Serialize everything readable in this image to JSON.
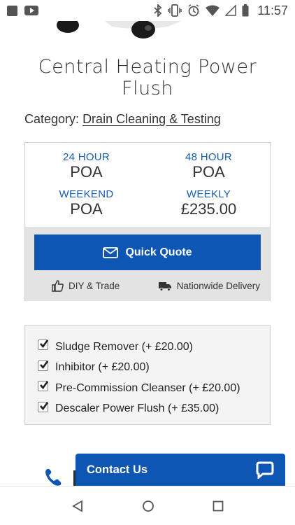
{
  "status_bar": {
    "time": "11:57"
  },
  "product": {
    "title_line1": "Central Heating Power",
    "title_line2": "Flush",
    "category_label": "Category:",
    "category_value": "Drain Cleaning & Testing"
  },
  "pricing": [
    {
      "label": "24 HOUR",
      "value": "POA"
    },
    {
      "label": "48 HOUR",
      "value": "POA"
    },
    {
      "label": "WEEKEND",
      "value": "POA"
    },
    {
      "label": "WEEKLY",
      "value": "£235.00"
    }
  ],
  "quote_button": {
    "label": "Quick Quote"
  },
  "features": {
    "diy": "DIY & Trade",
    "delivery": "Nationwide Delivery"
  },
  "options": [
    {
      "label": "Sludge Remover (+ £20.00)",
      "checked": true
    },
    {
      "label": "Inhibitor (+ £20.00)",
      "checked": true
    },
    {
      "label": "Pre-Commission Cleanser (+ £20.00)",
      "checked": true
    },
    {
      "label": "Descaler Power Flush (+ £35.00)",
      "checked": true
    }
  ],
  "contact": {
    "label": "Contact Us"
  },
  "colors": {
    "brand_blue": "#0d56b4",
    "label_blue": "#1a5cae",
    "panel_gray": "#e3e3e3"
  },
  "icons": [
    "youtube-icon",
    "bluetooth-icon",
    "vibrate-icon",
    "alarm-icon",
    "wifi-icon",
    "signal-icon",
    "battery-icon",
    "envelope-icon",
    "thumbs-up-icon",
    "truck-icon",
    "phone-icon",
    "chat-icon",
    "back-icon",
    "home-icon",
    "recents-icon"
  ]
}
